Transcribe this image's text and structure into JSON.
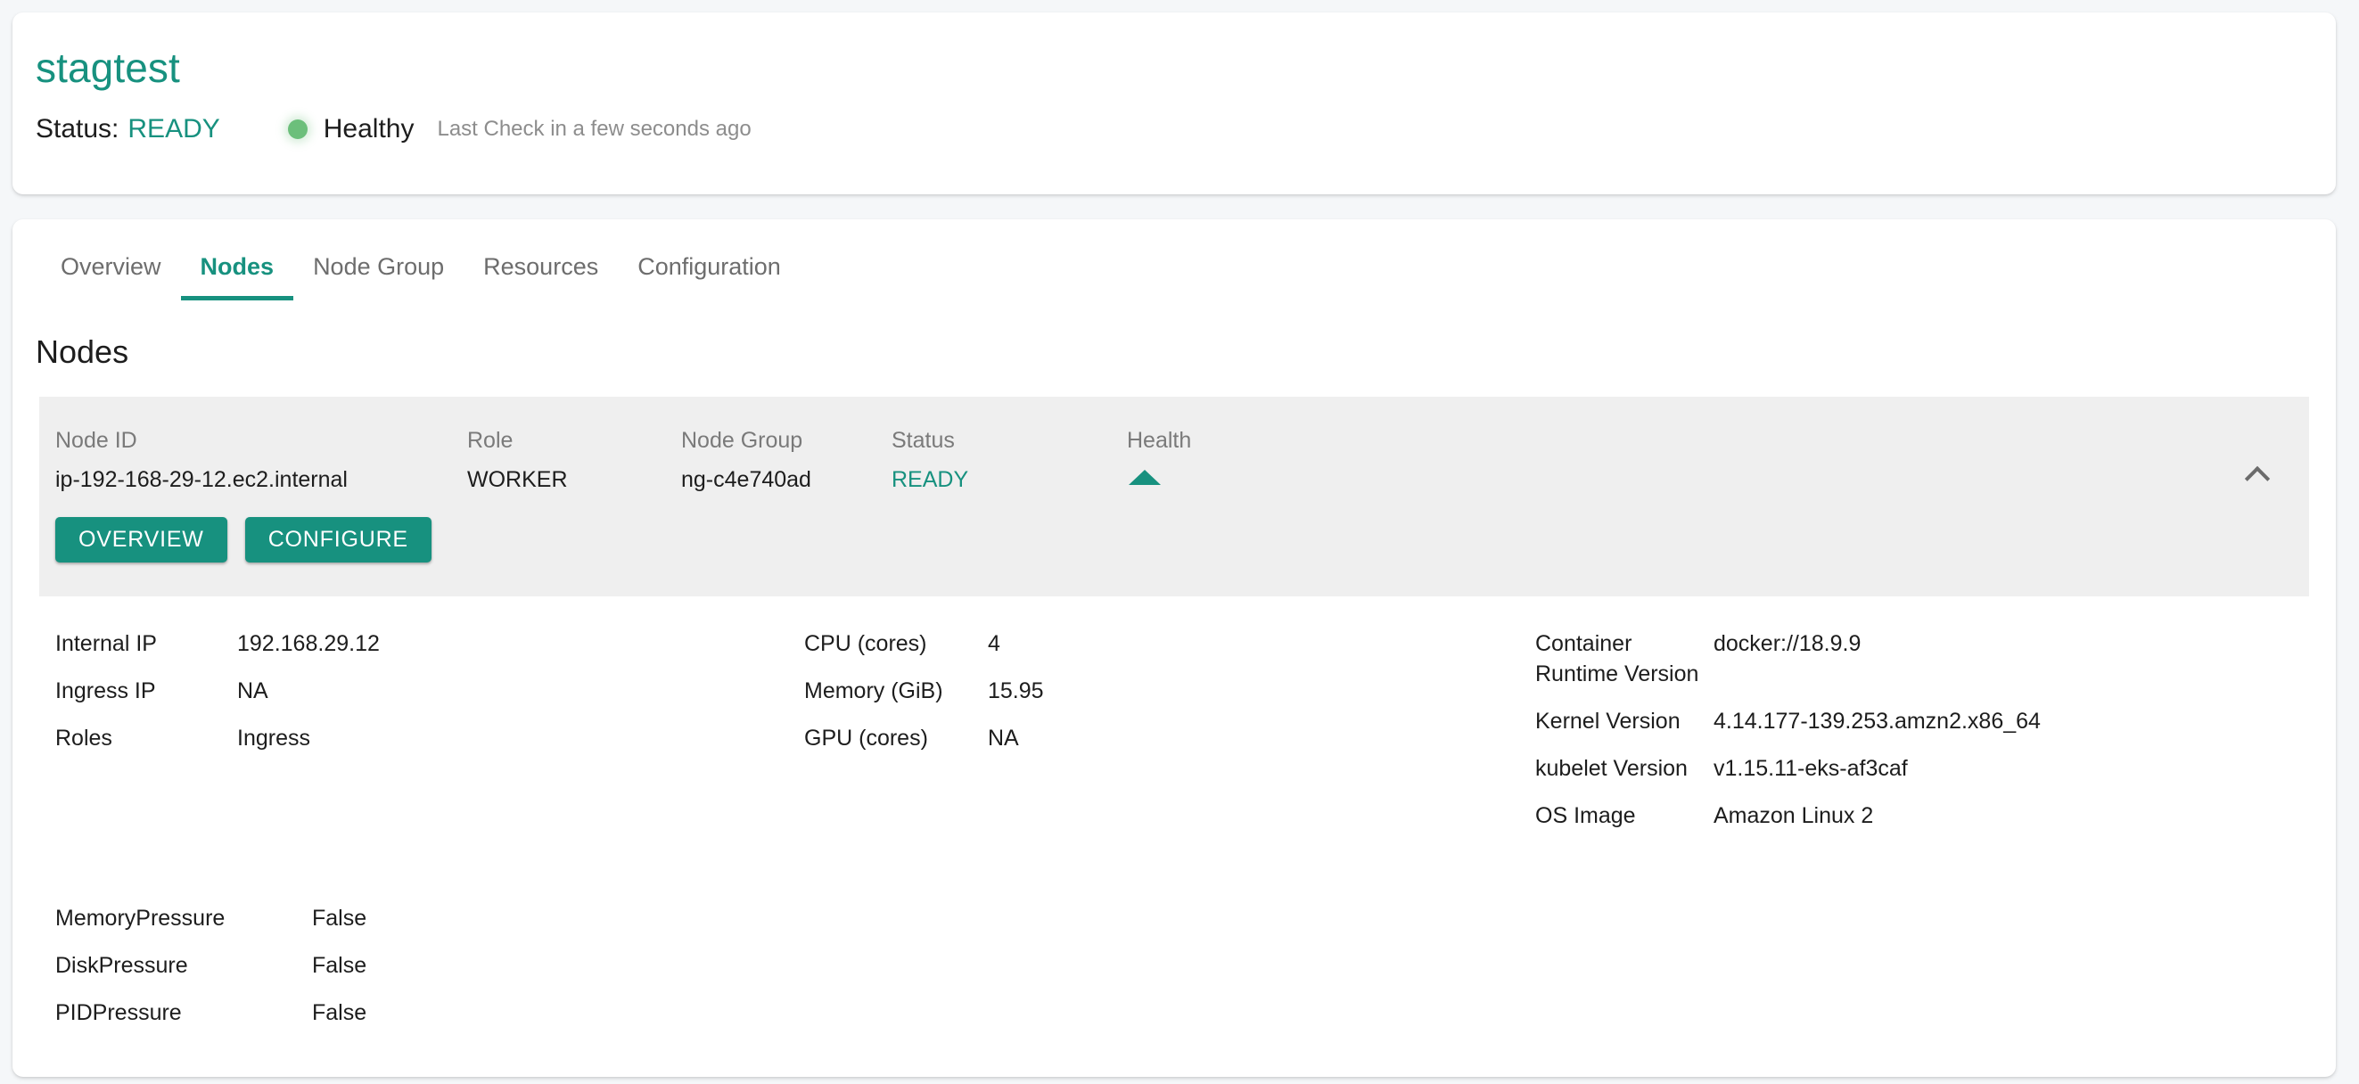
{
  "header": {
    "cluster_name": "stagtest",
    "status_label": "Status:",
    "status_value": "READY",
    "health_text": "Healthy",
    "last_check": "Last Check in a few seconds ago",
    "health_dot_color": "#6cbf7b",
    "accent_color": "#17917f"
  },
  "tabs": [
    {
      "label": "Overview",
      "active": false
    },
    {
      "label": "Nodes",
      "active": true
    },
    {
      "label": "Node Group",
      "active": false
    },
    {
      "label": "Resources",
      "active": false
    },
    {
      "label": "Configuration",
      "active": false
    }
  ],
  "section": {
    "title": "Nodes"
  },
  "node": {
    "summary": {
      "node_id_label": "Node ID",
      "node_id_value": "ip-192-168-29-12.ec2.internal",
      "role_label": "Role",
      "role_value": "WORKER",
      "node_group_label": "Node Group",
      "node_group_value": "ng-c4e740ad",
      "status_label": "Status",
      "status_value": "READY",
      "health_label": "Health",
      "health_icon": "triangle-up-icon"
    },
    "buttons": {
      "overview": "OVERVIEW",
      "configure": "CONFIGURE"
    },
    "collapse_icon": "chevron-up-icon",
    "details_col1": [
      {
        "key": "Internal IP",
        "value": "192.168.29.12"
      },
      {
        "key": "Ingress IP",
        "value": "NA"
      },
      {
        "key": "Roles",
        "value": "Ingress"
      }
    ],
    "details_col2": [
      {
        "key": "CPU (cores)",
        "value": "4"
      },
      {
        "key": "Memory (GiB)",
        "value": "15.95"
      },
      {
        "key": "GPU (cores)",
        "value": "NA"
      }
    ],
    "details_col3": [
      {
        "key": "Container Runtime Version",
        "value": "docker://18.9.9"
      },
      {
        "key": "Kernel Version",
        "value": "4.14.177-139.253.amzn2.x86_64"
      },
      {
        "key": "kubelet Version",
        "value": "v1.15.11-eks-af3caf"
      },
      {
        "key": "OS Image",
        "value": "Amazon Linux 2"
      }
    ],
    "pressures": [
      {
        "key": "MemoryPressure",
        "value": "False"
      },
      {
        "key": "DiskPressure",
        "value": "False"
      },
      {
        "key": "PIDPressure",
        "value": "False"
      }
    ]
  }
}
